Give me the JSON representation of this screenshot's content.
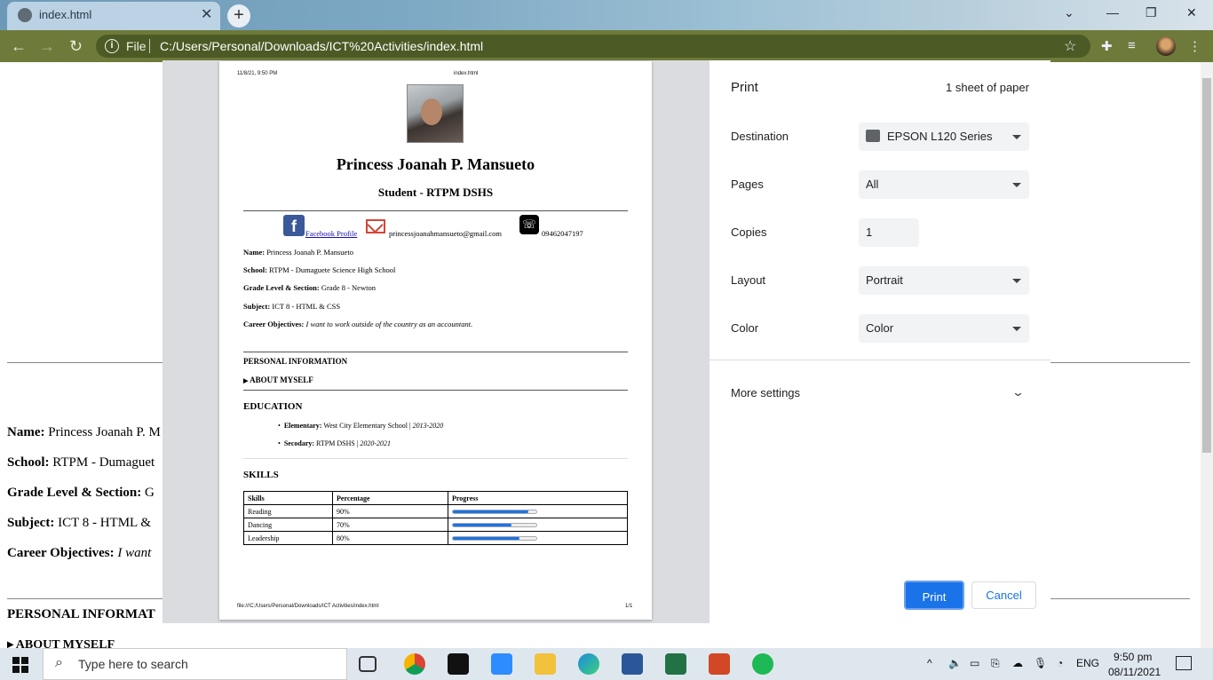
{
  "browser": {
    "tab_title": "index.html",
    "tab_close": "✕",
    "new_tab": "+",
    "omnibox_scheme": "File",
    "omnibox_url": "C:/Users/Personal/Downloads/ICT%20Activities/index.html"
  },
  "background_page": {
    "name_label": "Name:",
    "name_value": "Princess Joanah P. M",
    "school_label": "School:",
    "school_value": "RTPM - Dumaguet",
    "grade_label": "Grade Level & Section:",
    "grade_value": "G",
    "subject_label": "Subject:",
    "subject_value": "ICT 8 - HTML &",
    "career_label": "Career Objectives:",
    "career_value": "I want",
    "personal_heading": "PERSONAL INFORMAT",
    "about_cut": "▸ ABOUT MYSELF"
  },
  "preview": {
    "header_date": "11/8/21, 9:50 PM",
    "header_title": "index.html",
    "name": "Princess Joanah P. Mansueto",
    "role": "Student - RTPM DSHS",
    "facebook_link": "Facebook Profile",
    "email": "princessjoanahmansueto@gmail.com",
    "phone": "09462047197",
    "name_label": "Name:",
    "name_value": "Princess Joanah P. Mansueto",
    "school_label": "School:",
    "school_value": "RTPM - Dumaguete Science High School",
    "grade_label": "Grade Level & Section:",
    "grade_value": "Grade 8 - Newton",
    "subject_label": "Subject:",
    "subject_value": "ICT 8 - HTML & CSS",
    "career_label": "Career Objectives:",
    "career_value": "I want to work outside of the country as an accountant.",
    "personal_heading": "PERSONAL INFORMATION",
    "about_myself": "ABOUT MYSELF",
    "education_heading": "EDUCATION",
    "edu_elem_label": "Elementary:",
    "edu_elem_value": "West City Elementary School |",
    "edu_elem_years": "2013-2020",
    "edu_sec_label": "Secodary:",
    "edu_sec_value": "RTPM DSHS |",
    "edu_sec_years": "2020-2021",
    "skills_heading": "SKILLS",
    "skills_headers": [
      "Skills",
      "Percentage",
      "Progress"
    ],
    "skills": [
      {
        "name": "Reading",
        "percent": "90%",
        "progress": 0.9
      },
      {
        "name": "Dancing",
        "percent": "70%",
        "progress": 0.7
      },
      {
        "name": "Leadership",
        "percent": "80%",
        "progress": 0.8
      }
    ],
    "footer_path": "file:///C:/Users/Personal/Downloads/ICT Activities/index.html",
    "footer_page": "1/1"
  },
  "print_panel": {
    "title": "Print",
    "sheets": "1 sheet of paper",
    "destination_label": "Destination",
    "destination_value": "EPSON L120 Series",
    "pages_label": "Pages",
    "pages_value": "All",
    "copies_label": "Copies",
    "copies_value": "1",
    "layout_label": "Layout",
    "layout_value": "Portrait",
    "color_label": "Color",
    "color_value": "Color",
    "more_settings": "More settings",
    "print_button": "Print",
    "cancel_button": "Cancel"
  },
  "taskbar": {
    "search_placeholder": "Type here to search",
    "language": "ENG",
    "time": "9:50 pm",
    "date": "08/11/2021"
  }
}
